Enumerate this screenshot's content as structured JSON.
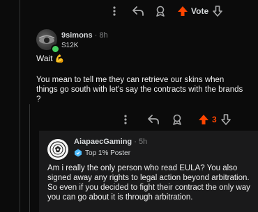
{
  "top_actions": {
    "vote_label": "Vote"
  },
  "comment_1": {
    "username": "9simons",
    "time": "8h",
    "karma": "S12K",
    "line1": "Wait",
    "emoji": "💪",
    "body": "You mean to tell me they can retrieve our skins when things go south with let's say the contracts with the brands ?",
    "vote_count": "3"
  },
  "comment_2": {
    "username": "AiapaecGaming",
    "time": "5h",
    "flair": "Top 1% Poster",
    "body": "Am i really the only person who read EULA? You also signed away any rights to legal action beyond arbitration. So even if you decided to fight their contract the only way you can go about it is through arbitration."
  },
  "colors": {
    "accent": "#ff4500",
    "background": "#0b0b0b",
    "card": "#1a1a1b",
    "online": "#46d160"
  }
}
